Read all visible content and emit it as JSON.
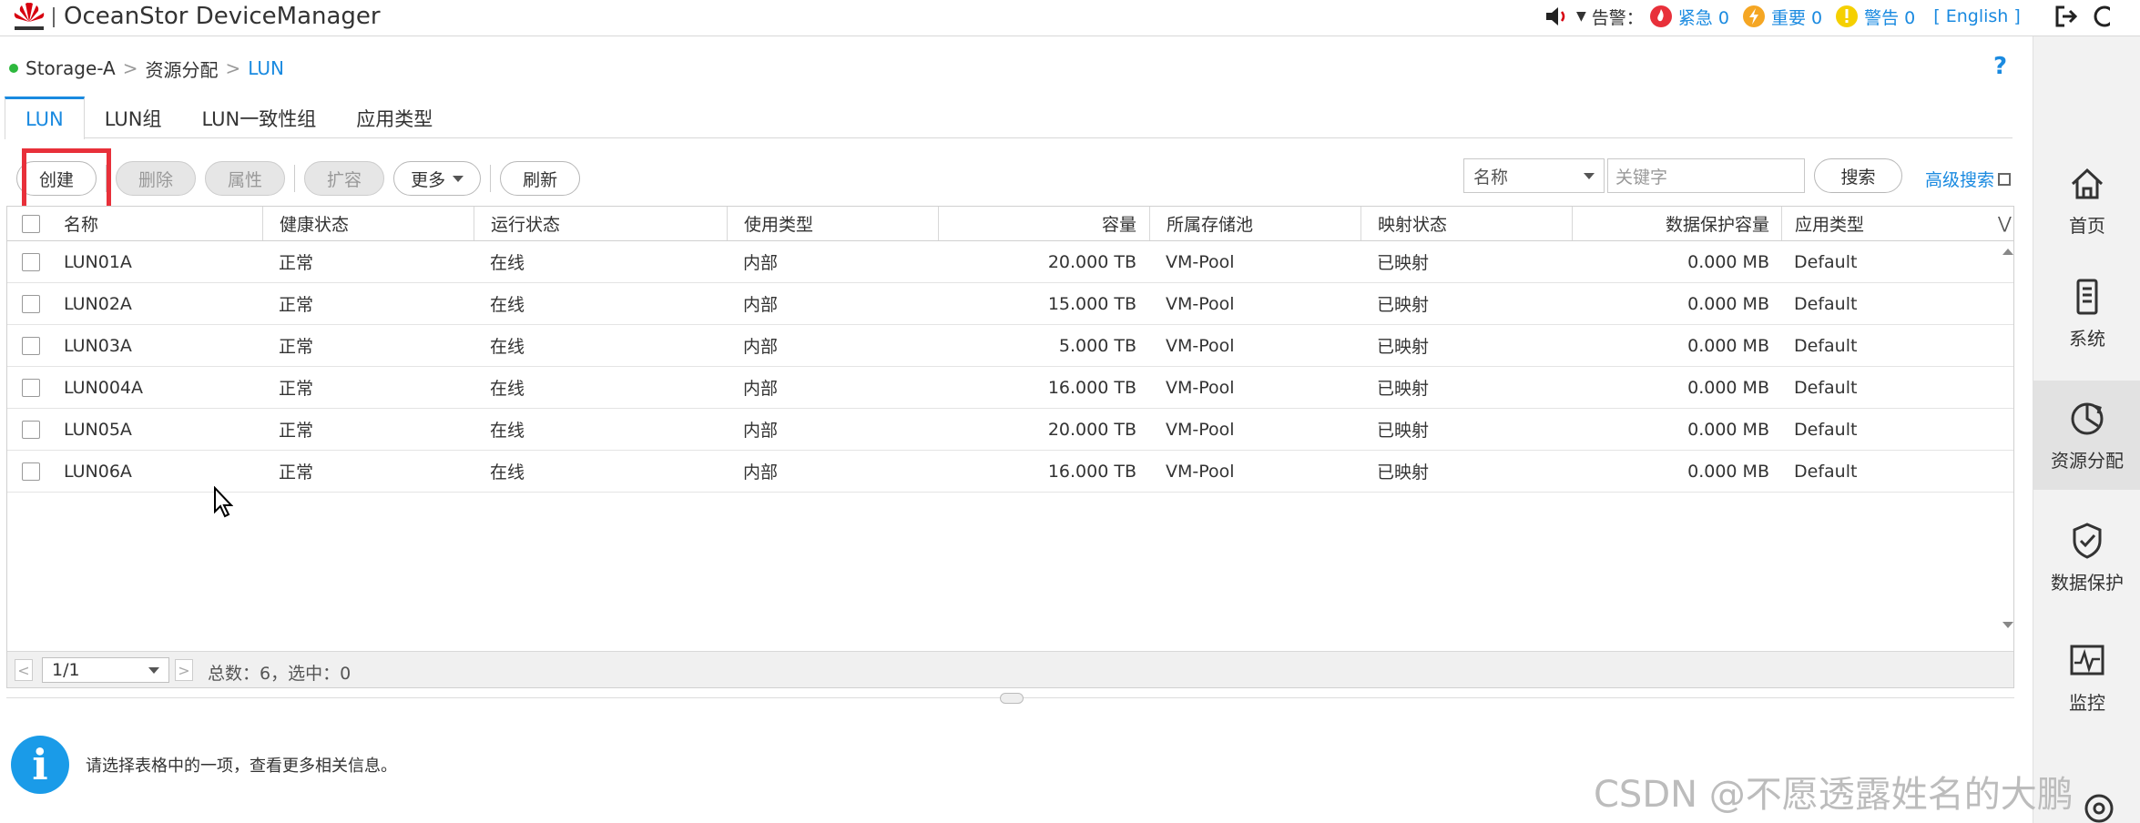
{
  "header": {
    "app_title": "OceanStor DeviceManager",
    "alarm_label": "告警：",
    "critical_label": "紧急",
    "critical_count": "0",
    "major_label": "重要",
    "major_count": "0",
    "warning_label": "警告",
    "warning_count": "0",
    "language": "[ English ]"
  },
  "breadcrumb": {
    "device": "Storage-A",
    "section": "资源分配",
    "current": "LUN"
  },
  "tabs": [
    {
      "label": "LUN"
    },
    {
      "label": "LUN组"
    },
    {
      "label": "LUN一致性组"
    },
    {
      "label": "应用类型"
    }
  ],
  "toolbar": {
    "create": "创建",
    "delete": "删除",
    "properties": "属性",
    "expand": "扩容",
    "more": "更多",
    "refresh": "刷新"
  },
  "search": {
    "field": "名称",
    "placeholder": "关键字",
    "button": "搜索",
    "advanced": "高级搜索"
  },
  "table": {
    "columns": [
      "名称",
      "健康状态",
      "运行状态",
      "使用类型",
      "容量",
      "所属存储池",
      "映射状态",
      "数据保护容量",
      "应用类型"
    ],
    "rows": [
      [
        "LUN01A",
        "正常",
        "在线",
        "内部",
        "20.000 TB",
        "VM-Pool",
        "已映射",
        "0.000 MB",
        "Default"
      ],
      [
        "LUN02A",
        "正常",
        "在线",
        "内部",
        "15.000 TB",
        "VM-Pool",
        "已映射",
        "0.000 MB",
        "Default"
      ],
      [
        "LUN03A",
        "正常",
        "在线",
        "内部",
        "5.000 TB",
        "VM-Pool",
        "已映射",
        "0.000 MB",
        "Default"
      ],
      [
        "LUN004A",
        "正常",
        "在线",
        "内部",
        "16.000 TB",
        "VM-Pool",
        "已映射",
        "0.000 MB",
        "Default"
      ],
      [
        "LUN05A",
        "正常",
        "在线",
        "内部",
        "20.000 TB",
        "VM-Pool",
        "已映射",
        "0.000 MB",
        "Default"
      ],
      [
        "LUN06A",
        "正常",
        "在线",
        "内部",
        "16.000 TB",
        "VM-Pool",
        "已映射",
        "0.000 MB",
        "Default"
      ]
    ]
  },
  "pagination": {
    "page": "1/1",
    "summary": "总数：6，选中：0"
  },
  "info": {
    "message": "请选择表格中的一项，查看更多相关信息。"
  },
  "nav": {
    "home": "首页",
    "system": "系统",
    "provisioning": "资源分配",
    "protection": "数据保护",
    "monitor": "监控"
  },
  "watermark": "CSDN @不愿透露姓名的大鹏",
  "colors": {
    "accent": "#1a8ae0",
    "highlight": "#e8303a",
    "critical": "#e8303a",
    "major": "#f5a623",
    "warning": "#f5d000",
    "online": "#2db83d"
  }
}
